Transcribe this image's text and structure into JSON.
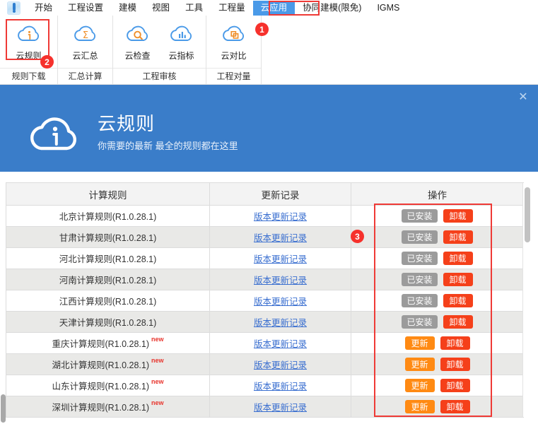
{
  "window": {
    "app_icon": "app-logo-icon"
  },
  "ribbon": {
    "tabs": [
      {
        "label": "开始",
        "active": false
      },
      {
        "label": "工程设置",
        "active": false
      },
      {
        "label": "建模",
        "active": false
      },
      {
        "label": "视图",
        "active": false
      },
      {
        "label": "工具",
        "active": false
      },
      {
        "label": "工程量",
        "active": false
      },
      {
        "label": "云应用",
        "active": true
      },
      {
        "label": "协同建模(限免)",
        "active": false
      },
      {
        "label": "IGMS",
        "active": false
      }
    ],
    "groups": [
      {
        "title": "规则下载",
        "items": [
          {
            "label": "云规则",
            "icon": "cloud-info-icon"
          }
        ]
      },
      {
        "title": "汇总计算",
        "items": [
          {
            "label": "云汇总",
            "icon": "cloud-sigma-icon"
          }
        ]
      },
      {
        "title": "工程审核",
        "items": [
          {
            "label": "云检查",
            "icon": "cloud-search-icon"
          },
          {
            "label": "云指标",
            "icon": "cloud-chart-icon"
          }
        ]
      },
      {
        "title": "工程对量",
        "items": [
          {
            "label": "云对比",
            "icon": "cloud-compare-icon"
          }
        ]
      }
    ]
  },
  "annotations": {
    "badge1": "1",
    "badge2": "2",
    "badge3": "3",
    "highlight_color": "#ef3a36"
  },
  "banner": {
    "title": "云规则",
    "subtitle": "你需要的最新 最全的规则都在这里",
    "close_label": "✕",
    "icon": "cloud-info-icon",
    "background_color": "#3a7dc9"
  },
  "table": {
    "columns": [
      "计算规则",
      "更新记录",
      "操作"
    ],
    "link_label": "版本更新记录",
    "new_tag": "new",
    "buttons": {
      "installed": "已安装",
      "update": "更新",
      "uninstall": "卸载"
    },
    "colors": {
      "installed": "#9b9b9b",
      "update": "#ff8a13",
      "uninstall": "#f5401a",
      "link": "#3a6fd0"
    },
    "rows": [
      {
        "name": "北京计算规则(R1.0.28.1)",
        "new": false,
        "link": "版本更新记录",
        "primary": "已安装",
        "primary_state": "installed",
        "secondary": "卸载"
      },
      {
        "name": "甘肃计算规则(R1.0.28.1)",
        "new": false,
        "link": "版本更新记录",
        "primary": "已安装",
        "primary_state": "installed",
        "secondary": "卸载"
      },
      {
        "name": "河北计算规则(R1.0.28.1)",
        "new": false,
        "link": "版本更新记录",
        "primary": "已安装",
        "primary_state": "installed",
        "secondary": "卸载"
      },
      {
        "name": "河南计算规则(R1.0.28.1)",
        "new": false,
        "link": "版本更新记录",
        "primary": "已安装",
        "primary_state": "installed",
        "secondary": "卸载"
      },
      {
        "name": "江西计算规则(R1.0.28.1)",
        "new": false,
        "link": "版本更新记录",
        "primary": "已安装",
        "primary_state": "installed",
        "secondary": "卸载"
      },
      {
        "name": "天津计算规则(R1.0.28.1)",
        "new": false,
        "link": "版本更新记录",
        "primary": "已安装",
        "primary_state": "installed",
        "secondary": "卸载"
      },
      {
        "name": "重庆计算规则(R1.0.28.1)",
        "new": true,
        "link": "版本更新记录",
        "primary": "更新",
        "primary_state": "update",
        "secondary": "卸载"
      },
      {
        "name": "湖北计算规则(R1.0.28.1)",
        "new": true,
        "link": "版本更新记录",
        "primary": "更新",
        "primary_state": "update",
        "secondary": "卸载"
      },
      {
        "name": "山东计算规则(R1.0.28.1)",
        "new": true,
        "link": "版本更新记录",
        "primary": "更新",
        "primary_state": "update",
        "secondary": "卸载"
      },
      {
        "name": "深圳计算规则(R1.0.28.1)",
        "new": true,
        "link": "版本更新记录",
        "primary": "更新",
        "primary_state": "update",
        "secondary": "卸载"
      }
    ]
  },
  "scrollbars": {
    "vertical_position": "top",
    "horizontal_position": "left"
  }
}
